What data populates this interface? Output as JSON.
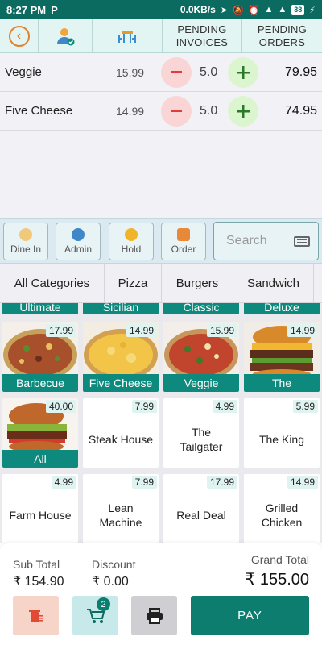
{
  "status_bar": {
    "time": "8:27 PM",
    "app_glyph": "P",
    "network_speed": "0.0KB/s",
    "battery": "38"
  },
  "header": {
    "back_icon": "back-arrow-icon",
    "user_icon": "admin-user-icon",
    "table_icon": "dining-table-icon",
    "pending_invoices_label": "PENDING\nINVOICES",
    "pending_orders_label": "PENDING\nORDERS"
  },
  "order_lines": [
    {
      "name": "Veggie",
      "price": "15.99",
      "qty": "5.0",
      "total": "79.95"
    },
    {
      "name": "Five Cheese",
      "price": "14.99",
      "qty": "5.0",
      "total": "74.95"
    }
  ],
  "actions": {
    "dine_in": "Dine In",
    "admin": "Admin",
    "hold": "Hold",
    "order": "Order",
    "search_placeholder": "Search"
  },
  "categories": [
    "All Categories",
    "Pizza",
    "Burgers",
    "Sandwich"
  ],
  "partial_row": [
    "Ultimate",
    "Sicilian",
    "Classic",
    "Deluxe"
  ],
  "products": [
    {
      "name": "Barbecue",
      "price": "17.99",
      "image": "pizza"
    },
    {
      "name": "Five Cheese",
      "price": "14.99",
      "image": "cheese-pizza"
    },
    {
      "name": "Veggie",
      "price": "15.99",
      "image": "pizza"
    },
    {
      "name": "The",
      "price": "14.99",
      "image": "burger"
    },
    {
      "name": "All",
      "price": "40.00",
      "image": "burger"
    },
    {
      "name": "Steak House",
      "price": "7.99",
      "image": ""
    },
    {
      "name": "The Tailgater",
      "price": "4.99",
      "image": ""
    },
    {
      "name": "The King",
      "price": "5.99",
      "image": ""
    },
    {
      "name": "Farm House",
      "price": "4.99",
      "image": ""
    },
    {
      "name": "Lean Machine",
      "price": "7.99",
      "image": ""
    },
    {
      "name": "Real Deal",
      "price": "17.99",
      "image": ""
    },
    {
      "name": "Grilled Chicken",
      "price": "14.99",
      "image": ""
    }
  ],
  "footer": {
    "subtotal_label": "Sub Total",
    "subtotal_value": "₹ 154.90",
    "discount_label": "Discount",
    "discount_value": "₹ 0.00",
    "grand_total_label": "Grand Total",
    "grand_total_value": "₹ 155.00",
    "cart_count": "2",
    "pay_label": "PAY"
  },
  "colors": {
    "primary": "#0d7d70",
    "status_bar": "#0c6b61",
    "minus_bg": "#f9d5d5",
    "plus_bg": "#dbf5cf"
  }
}
